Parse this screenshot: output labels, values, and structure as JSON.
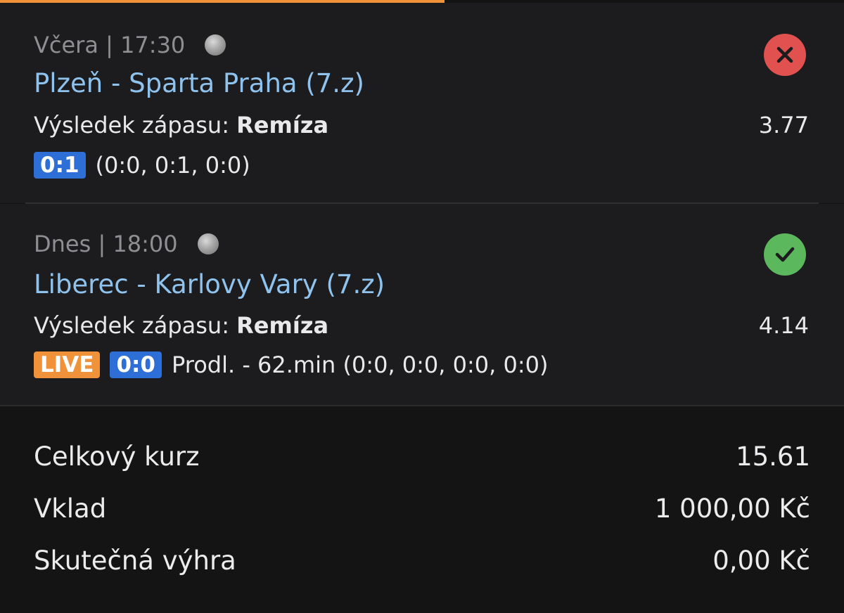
{
  "colors": {
    "accent_orange": "#f0923a",
    "link_blue": "#8fc3ee",
    "score_blue": "#2d6fd6",
    "lost_red": "#e0514f",
    "won_green": "#5cb85c"
  },
  "bets": [
    {
      "meta": "Včera | 17:30",
      "match": "Plzeň - Sparta Praha (7.z)",
      "market_label": "Výsledek zápasu:",
      "pick": "Remíza",
      "odds": "3.77",
      "live_label": "",
      "score": "0:1",
      "score_detail": "(0:0, 0:1, 0:0)",
      "status": "lost",
      "status_icon": "close-icon"
    },
    {
      "meta": "Dnes | 18:00",
      "match": "Liberec - Karlovy Vary (7.z)",
      "market_label": "Výsledek zápasu:",
      "pick": "Remíza",
      "odds": "4.14",
      "live_label": "LIVE",
      "score": "0:0",
      "score_detail": "Prodl. - 62.min (0:0, 0:0, 0:0, 0:0)",
      "status": "won",
      "status_icon": "check-icon"
    }
  ],
  "summary": {
    "total_odds_label": "Celkový kurz",
    "total_odds_value": "15.61",
    "stake_label": "Vklad",
    "stake_value": "1 000,00 Kč",
    "win_label": "Skutečná výhra",
    "win_value": "0,00 Kč"
  }
}
